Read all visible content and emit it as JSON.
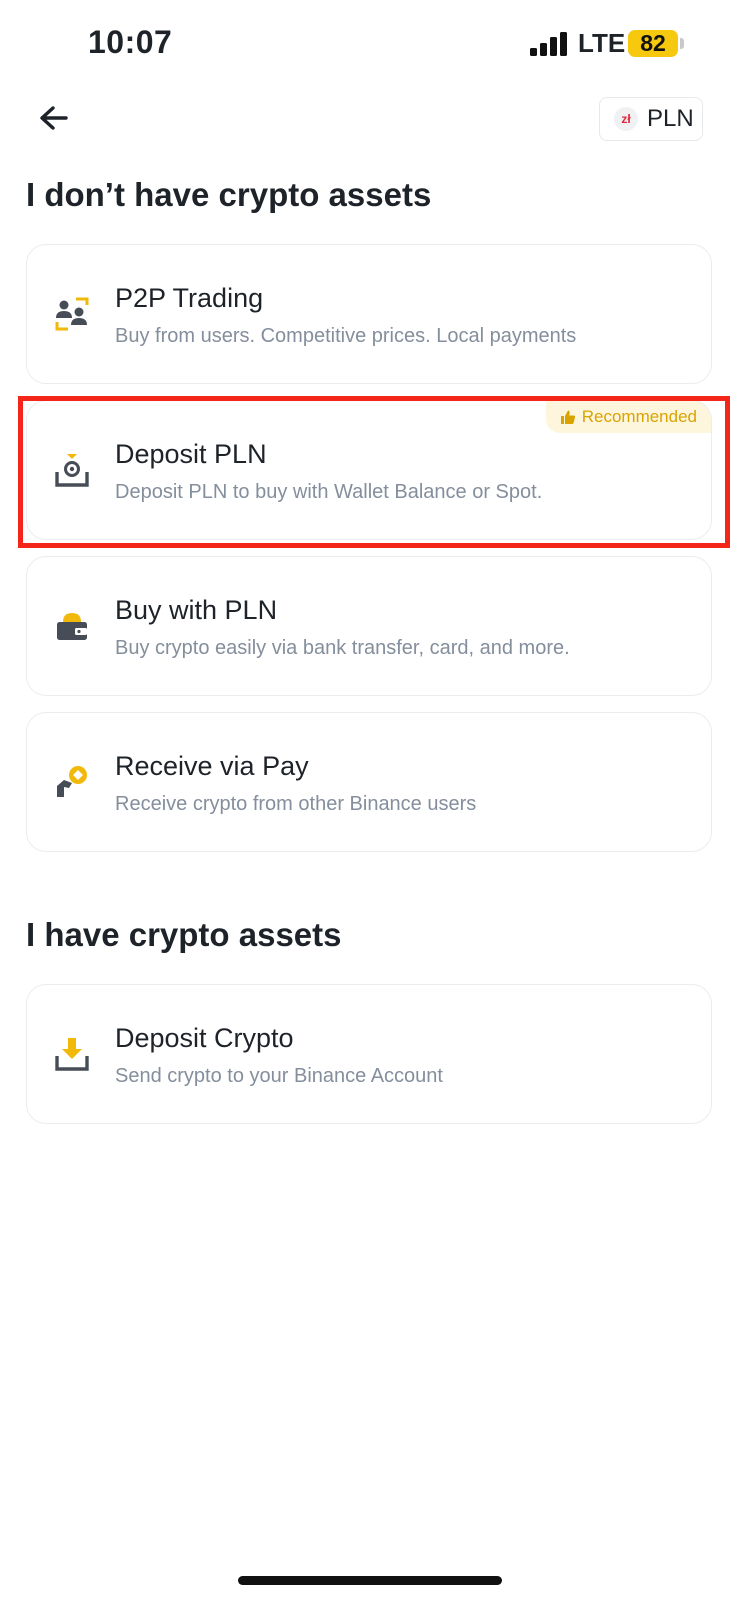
{
  "status_bar": {
    "time": "10:07",
    "network": "LTE",
    "battery": "82"
  },
  "header": {
    "currency_symbol": "zł",
    "currency": "PLN"
  },
  "sections": [
    {
      "title": "I don’t have crypto assets",
      "items": [
        {
          "title": "P2P Trading",
          "subtitle": "Buy from users. Competitive prices. Local payments",
          "icon": "p2p-users-icon"
        },
        {
          "title": "Deposit PLN",
          "subtitle": "Deposit PLN to buy with Wallet Balance or Spot.",
          "icon": "deposit-fiat-icon",
          "badge": "Recommended",
          "highlighted": true
        },
        {
          "title": "Buy with PLN",
          "subtitle": "Buy crypto easily via bank transfer, card, and more.",
          "icon": "wallet-icon"
        },
        {
          "title": "Receive via Pay",
          "subtitle": "Receive crypto from other Binance users",
          "icon": "pay-receive-icon"
        }
      ]
    },
    {
      "title": "I have crypto assets",
      "items": [
        {
          "title": "Deposit Crypto",
          "subtitle": "Send crypto to your Binance Account",
          "icon": "deposit-tray-icon"
        }
      ]
    }
  ],
  "colors": {
    "accent": "#F0B90B",
    "text_primary": "#1E2329",
    "text_secondary": "#848E9C",
    "highlight": "#F4261A",
    "badge_bg": "#FDF6DC",
    "badge_text": "#D9A300"
  }
}
